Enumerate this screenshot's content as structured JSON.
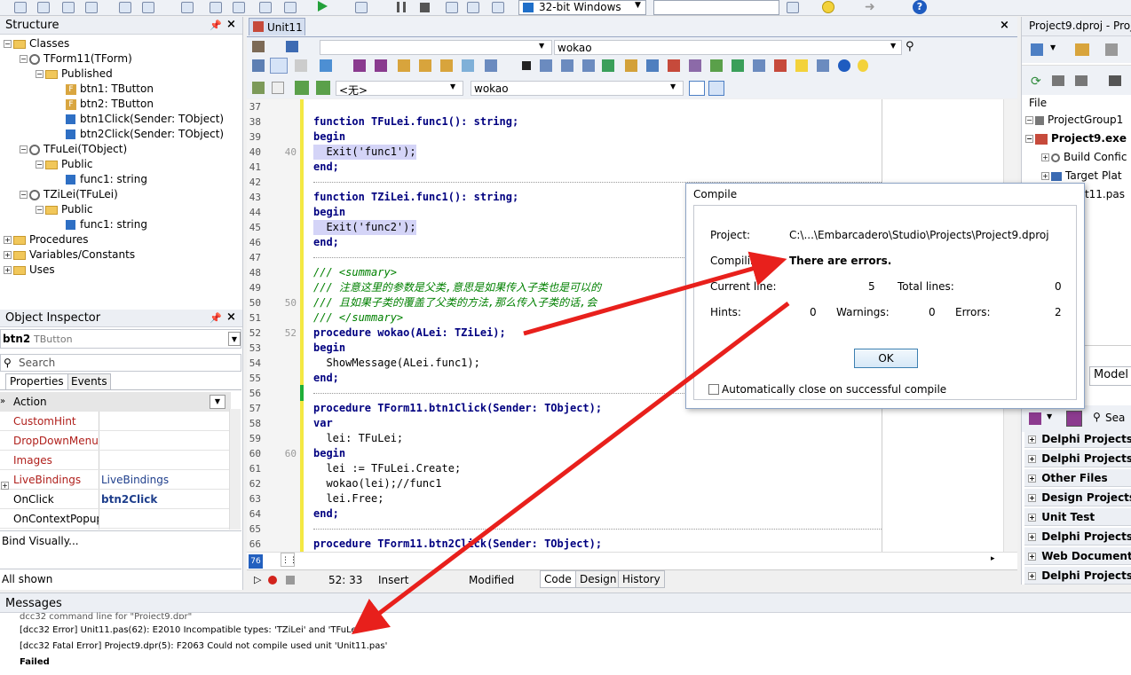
{
  "toolbar": {
    "platform": "32-bit Windows",
    "platform_dropdown_icon": "chevron-down-icon"
  },
  "structure": {
    "title": "Structure",
    "items": [
      {
        "label": "Classes"
      },
      {
        "label": "TForm11(TForm)"
      },
      {
        "label": "Published"
      },
      {
        "label": "btn1: TButton"
      },
      {
        "label": "btn2: TButton"
      },
      {
        "label": "btn1Click(Sender: TObject)"
      },
      {
        "label": "btn2Click(Sender: TObject)"
      },
      {
        "label": "TFuLei(TObject)"
      },
      {
        "label": "Public"
      },
      {
        "label": "func1: string"
      },
      {
        "label": "TZiLei(TFuLei)"
      },
      {
        "label": "Public"
      },
      {
        "label": "func1: string"
      },
      {
        "label": "Procedures"
      },
      {
        "label": "Variables/Constants"
      },
      {
        "label": "Uses"
      }
    ]
  },
  "editor": {
    "tab": "Unit11",
    "method_combo": "wokao",
    "class_combo": "<无>",
    "method_combo2": "wokao",
    "lines": [
      {
        "n": "37",
        "n2": "",
        "t": ""
      },
      {
        "n": "38",
        "n2": "",
        "t": "function TFuLei.func1(): string;"
      },
      {
        "n": "39",
        "n2": "",
        "t": "begin"
      },
      {
        "n": "40",
        "n2": "40",
        "t": "  Exit('func1');"
      },
      {
        "n": "41",
        "n2": "",
        "t": "end;"
      },
      {
        "n": "42",
        "n2": "",
        "t": ""
      },
      {
        "n": "43",
        "n2": "",
        "t": "function TZiLei.func1(): string;"
      },
      {
        "n": "44",
        "n2": "",
        "t": "begin"
      },
      {
        "n": "45",
        "n2": "",
        "t": "  Exit('func2');"
      },
      {
        "n": "46",
        "n2": "",
        "t": "end;"
      },
      {
        "n": "47",
        "n2": "",
        "t": ""
      },
      {
        "n": "48",
        "n2": "",
        "t": "/// <summary>"
      },
      {
        "n": "49",
        "n2": "",
        "t": "/// 注意这里的参数是父类,意思是如果传入子类也是可以的"
      },
      {
        "n": "50",
        "n2": "50",
        "t": "/// 且如果子类的覆盖了父类的方法,那么传入子类的话,会"
      },
      {
        "n": "51",
        "n2": "",
        "t": "/// </summary>"
      },
      {
        "n": "52",
        "n2": "52",
        "t": "procedure wokao(ALei: TZiLei);"
      },
      {
        "n": "53",
        "n2": "",
        "t": "begin"
      },
      {
        "n": "54",
        "n2": "",
        "t": "  ShowMessage(ALei.func1);"
      },
      {
        "n": "55",
        "n2": "",
        "t": "end;"
      },
      {
        "n": "56",
        "n2": "",
        "t": ""
      },
      {
        "n": "57",
        "n2": "",
        "t": "procedure TForm11.btn1Click(Sender: TObject);"
      },
      {
        "n": "58",
        "n2": "",
        "t": "var"
      },
      {
        "n": "59",
        "n2": "",
        "t": "  lei: TFuLei;"
      },
      {
        "n": "60",
        "n2": "60",
        "t": "begin"
      },
      {
        "n": "61",
        "n2": "",
        "t": "  lei := TFuLei.Create;"
      },
      {
        "n": "62",
        "n2": "",
        "t": "  wokao(lei);//func1"
      },
      {
        "n": "63",
        "n2": "",
        "t": "  lei.Free;"
      },
      {
        "n": "64",
        "n2": "",
        "t": "end;"
      },
      {
        "n": "65",
        "n2": "",
        "t": ""
      },
      {
        "n": "66",
        "n2": "",
        "t": "procedure TForm11.btn2Click(Sender: TObject);"
      }
    ],
    "status": {
      "pos": "52: 33",
      "mode": "Insert",
      "modified": "Modified",
      "line_marker": "76"
    },
    "tabs": [
      "Code",
      "Design",
      "History"
    ]
  },
  "inspector": {
    "title": "Object Inspector",
    "object": "btn2",
    "object_type": "TButton",
    "search": "Search",
    "tabs": [
      "Properties",
      "Events"
    ],
    "rows": [
      {
        "name": "Action",
        "value": ""
      },
      {
        "name": "CustomHint",
        "value": ""
      },
      {
        "name": "DropDownMenu",
        "value": ""
      },
      {
        "name": "Images",
        "value": ""
      },
      {
        "name": "LiveBindings",
        "value": "LiveBindings"
      },
      {
        "name": "OnClick",
        "value": "btn2Click"
      },
      {
        "name": "OnContextPopup",
        "value": ""
      }
    ],
    "bind_visually": "Bind Visually...",
    "all_shown": "All shown"
  },
  "messages": {
    "title": "Messages",
    "lines": [
      "dcc32 command line for \"Project9.dpr\"",
      "[dcc32 Error] Unit11.pas(62): E2010 Incompatible types: 'TZiLei' and 'TFuLei'",
      "[dcc32 Fatal Error] Project9.dpr(5): F2063 Could not compile used unit 'Unit11.pas'",
      "Failed"
    ]
  },
  "compile": {
    "title": "Compile",
    "project_label": "Project:",
    "project_value": "C:\\...\\Embarcadero\\Studio\\Projects\\Project9.dproj",
    "compiling_label": "Compiling:",
    "compiling_value": "There are errors.",
    "current_line_label": "Current line:",
    "current_line_value": "5",
    "total_lines_label": "Total lines:",
    "total_lines_value": "0",
    "hints_label": "Hints:",
    "hints_value": "0",
    "warnings_label": "Warnings:",
    "warnings_value": "0",
    "errors_label": "Errors:",
    "errors_value": "2",
    "ok": "OK",
    "auto_close": "Automatically close on successful compile"
  },
  "project": {
    "title": "Project9.dproj - Proj",
    "file_label": "File",
    "items": [
      {
        "label": "ProjectGroup1"
      },
      {
        "label": "Project9.exe"
      },
      {
        "label": "Build Confic"
      },
      {
        "label": "Target Plat"
      },
      {
        "label": "nit11.pas"
      }
    ],
    "model_tab": "Model",
    "search": "Sea",
    "gallery": [
      "Delphi Projects",
      "Delphi Projects |",
      "Other Files",
      "Design Projects",
      "Unit Test",
      "Delphi Projects |",
      "Web Documents",
      "Delphi Projects |"
    ]
  },
  "colors": {
    "arrow": "#e8201c",
    "gutter_bar": "#f4e842",
    "gutter_green": "#1fae38"
  }
}
